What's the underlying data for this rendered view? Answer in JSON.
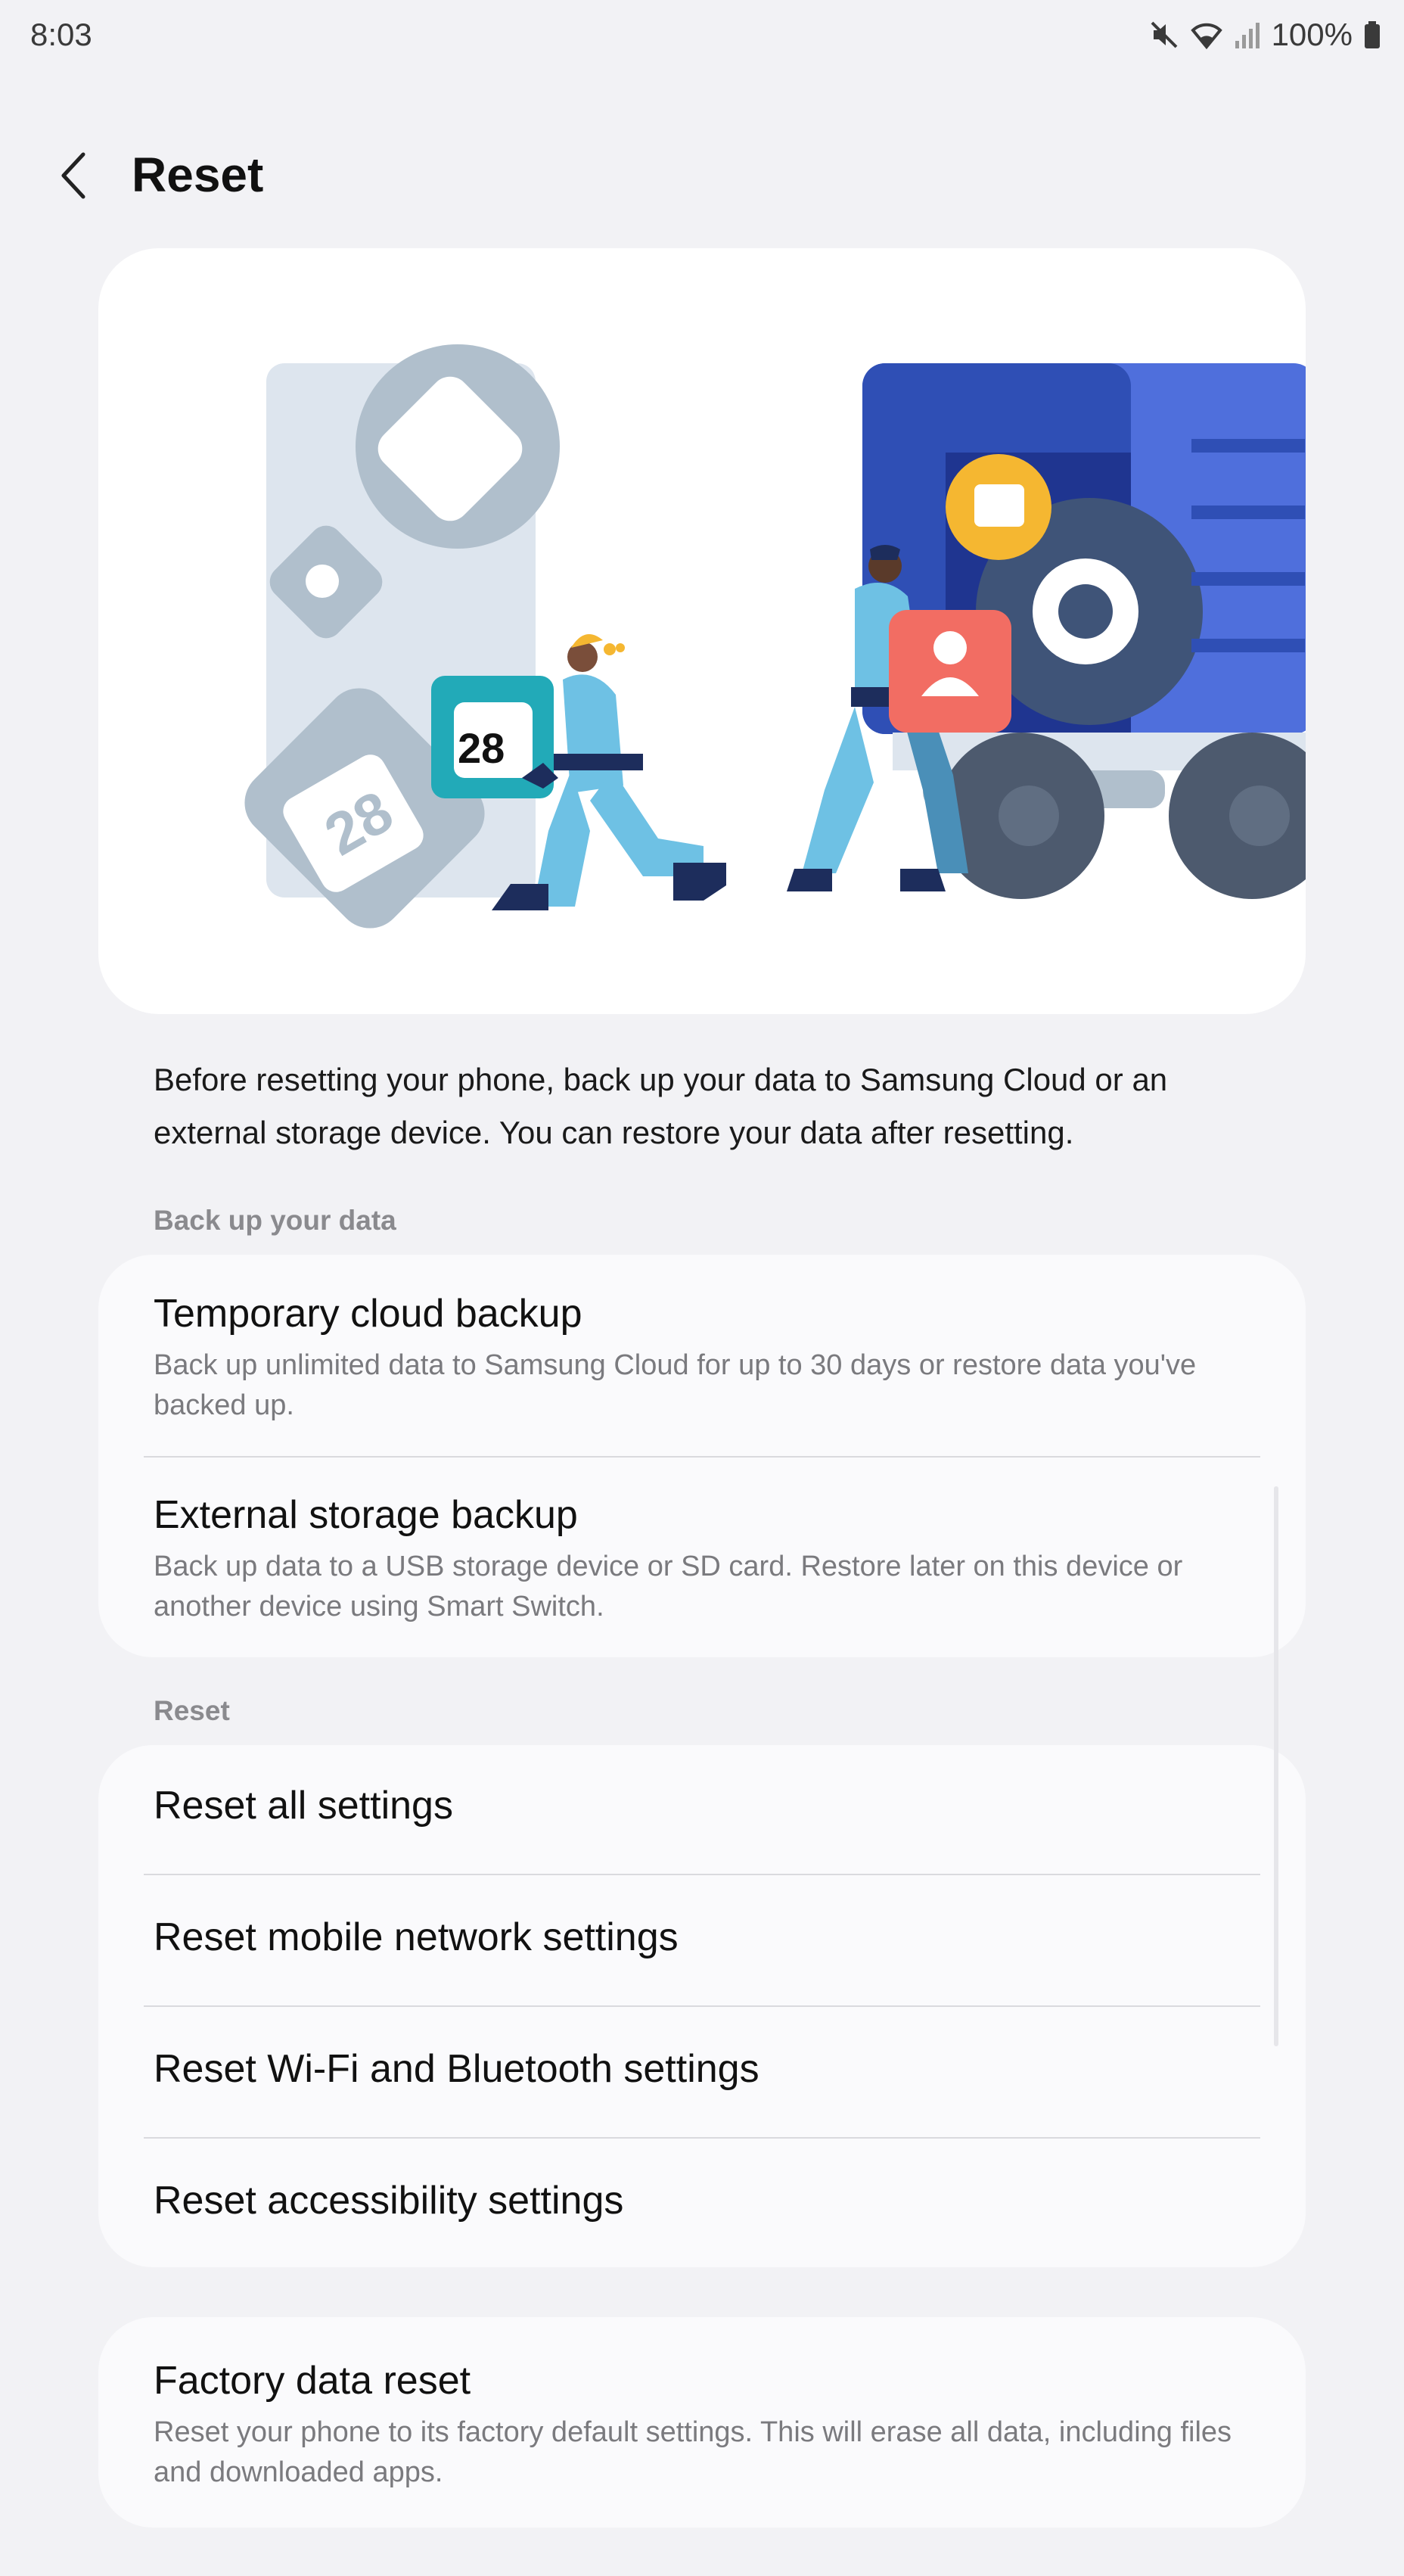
{
  "status_bar": {
    "time": "8:03",
    "battery": "100%",
    "icons": [
      "mute-icon",
      "wifi-icon",
      "signal-icon",
      "battery-icon"
    ]
  },
  "header": {
    "back_icon": "back-chevron-icon",
    "title": "Reset"
  },
  "illustration": {
    "calendar_number": "28",
    "calendar_number_rotated": "28"
  },
  "description": "Before resetting your phone, back up your data to Samsung Cloud or an external storage device. You can restore your data after resetting.",
  "backup_section": {
    "label": "Back up your data",
    "items": [
      {
        "title": "Temporary cloud backup",
        "subtitle": "Back up unlimited data to Samsung Cloud for up to 30 days or restore data you've backed up."
      },
      {
        "title": "External storage backup",
        "subtitle": "Back up data to a USB storage device or SD card. Restore later on this device or another device using Smart Switch."
      }
    ]
  },
  "reset_section": {
    "label": "Reset",
    "items": [
      {
        "title": "Reset all settings"
      },
      {
        "title": "Reset mobile network settings"
      },
      {
        "title": "Reset Wi-Fi and Bluetooth settings"
      },
      {
        "title": "Reset accessibility settings"
      }
    ]
  },
  "factory_reset": {
    "title": "Factory data reset",
    "subtitle": "Reset your phone to its factory default settings. This will erase all data, including files and downloaded apps."
  },
  "colors": {
    "background": "#f2f2f5",
    "card": "#fafafc",
    "truck_dark": "#2f4fb5",
    "truck_light": "#4f6fdc",
    "calendar_teal": "#22aab8",
    "contact_coral": "#f26d63",
    "folder_yellow": "#f5b731"
  }
}
